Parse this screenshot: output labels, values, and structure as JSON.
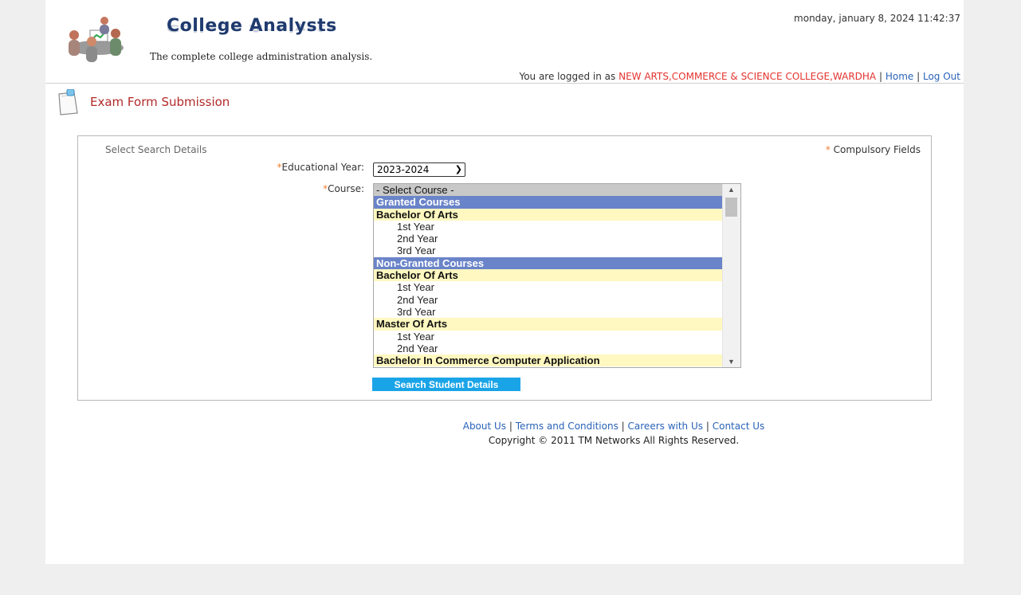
{
  "header": {
    "brand": "College Analysts",
    "tagline": "The complete college administration analysis.",
    "datetime": "monday, january 8, 2024 11:42:37",
    "login_prefix": "You are logged in as",
    "college": "NEW ARTS,COMMERCE & SCIENCE COLLEGE,WARDHA",
    "separator": "|",
    "home_link": "Home",
    "logout_link": "Log Out"
  },
  "page": {
    "title": "Exam Form Submission"
  },
  "form": {
    "section_label": "Select Search Details",
    "required_marker": "*",
    "compulsory_label": "Compulsory Fields",
    "year_label": "Educational Year:",
    "year_value": "2023-2024",
    "course_label": "Course:",
    "course_options": [
      {
        "label": "- Select Course -",
        "kind": "selected"
      },
      {
        "label": "Granted Courses",
        "kind": "group"
      },
      {
        "label": "Bachelor Of Arts",
        "kind": "course"
      },
      {
        "label": "1st Year",
        "kind": "year"
      },
      {
        "label": "2nd Year",
        "kind": "year"
      },
      {
        "label": "3rd Year",
        "kind": "year"
      },
      {
        "label": "Non-Granted Courses",
        "kind": "group"
      },
      {
        "label": "Bachelor Of Arts",
        "kind": "course"
      },
      {
        "label": "1st Year",
        "kind": "year"
      },
      {
        "label": "2nd Year",
        "kind": "year"
      },
      {
        "label": "3rd Year",
        "kind": "year"
      },
      {
        "label": "Master Of Arts",
        "kind": "course"
      },
      {
        "label": "1st Year",
        "kind": "year"
      },
      {
        "label": "2nd Year",
        "kind": "year"
      },
      {
        "label": "Bachelor In Commerce Computer Application",
        "kind": "course"
      }
    ],
    "search_button": "Search Student Details"
  },
  "footer": {
    "about": "About Us",
    "terms": "Terms and Conditions",
    "careers": "Careers with Us",
    "contact": "Contact Us",
    "separator": "|",
    "copyright": "Copyright © 2011 TM Networks All Rights Reserved."
  },
  "icons": {
    "logo": "people-chart-logo-icon",
    "page": "document-icon",
    "chevron": "chevron-down-icon"
  },
  "colors": {
    "accent_red": "#b22a2a",
    "college_red": "#e3342f",
    "link_blue": "#2a63b8",
    "group_bg": "#6a84c9",
    "course_bg": "#fff8c0",
    "button_bg": "#1aa4e8"
  }
}
